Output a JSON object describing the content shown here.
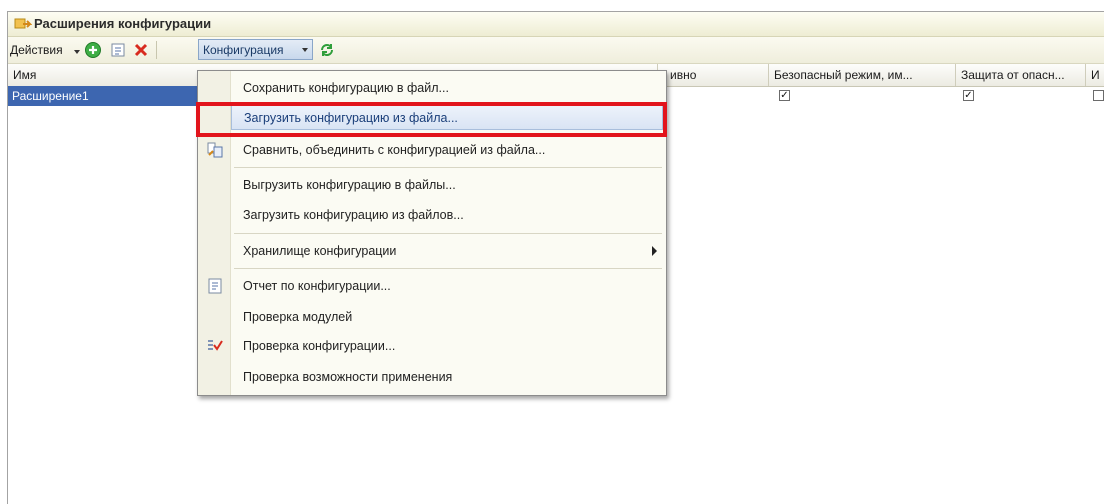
{
  "window": {
    "title": "Расширения конфигурации"
  },
  "toolbar": {
    "actions_label": "Действия",
    "config_label": "Конфигурация"
  },
  "grid": {
    "columns": [
      "Имя",
      "ивно",
      "Безопасный режим, им...",
      "Защита от опасн...",
      "И"
    ],
    "row": {
      "name": "Расширение1"
    }
  },
  "menu": {
    "items": [
      "Сохранить конфигурацию в файл...",
      "Загрузить конфигурацию из файла...",
      "Сравнить, объединить с конфигурацией из файла...",
      "Выгрузить конфигурацию в файлы...",
      "Загрузить конфигурацию из файлов...",
      "Хранилище конфигурации",
      "Отчет по конфигурации...",
      "Проверка модулей",
      "Проверка конфигурации...",
      "Проверка возможности применения"
    ]
  },
  "colors": {
    "highlight_box": "#e2141c",
    "selection": "#3d66b0",
    "accent_green": "#2f9e3a"
  }
}
